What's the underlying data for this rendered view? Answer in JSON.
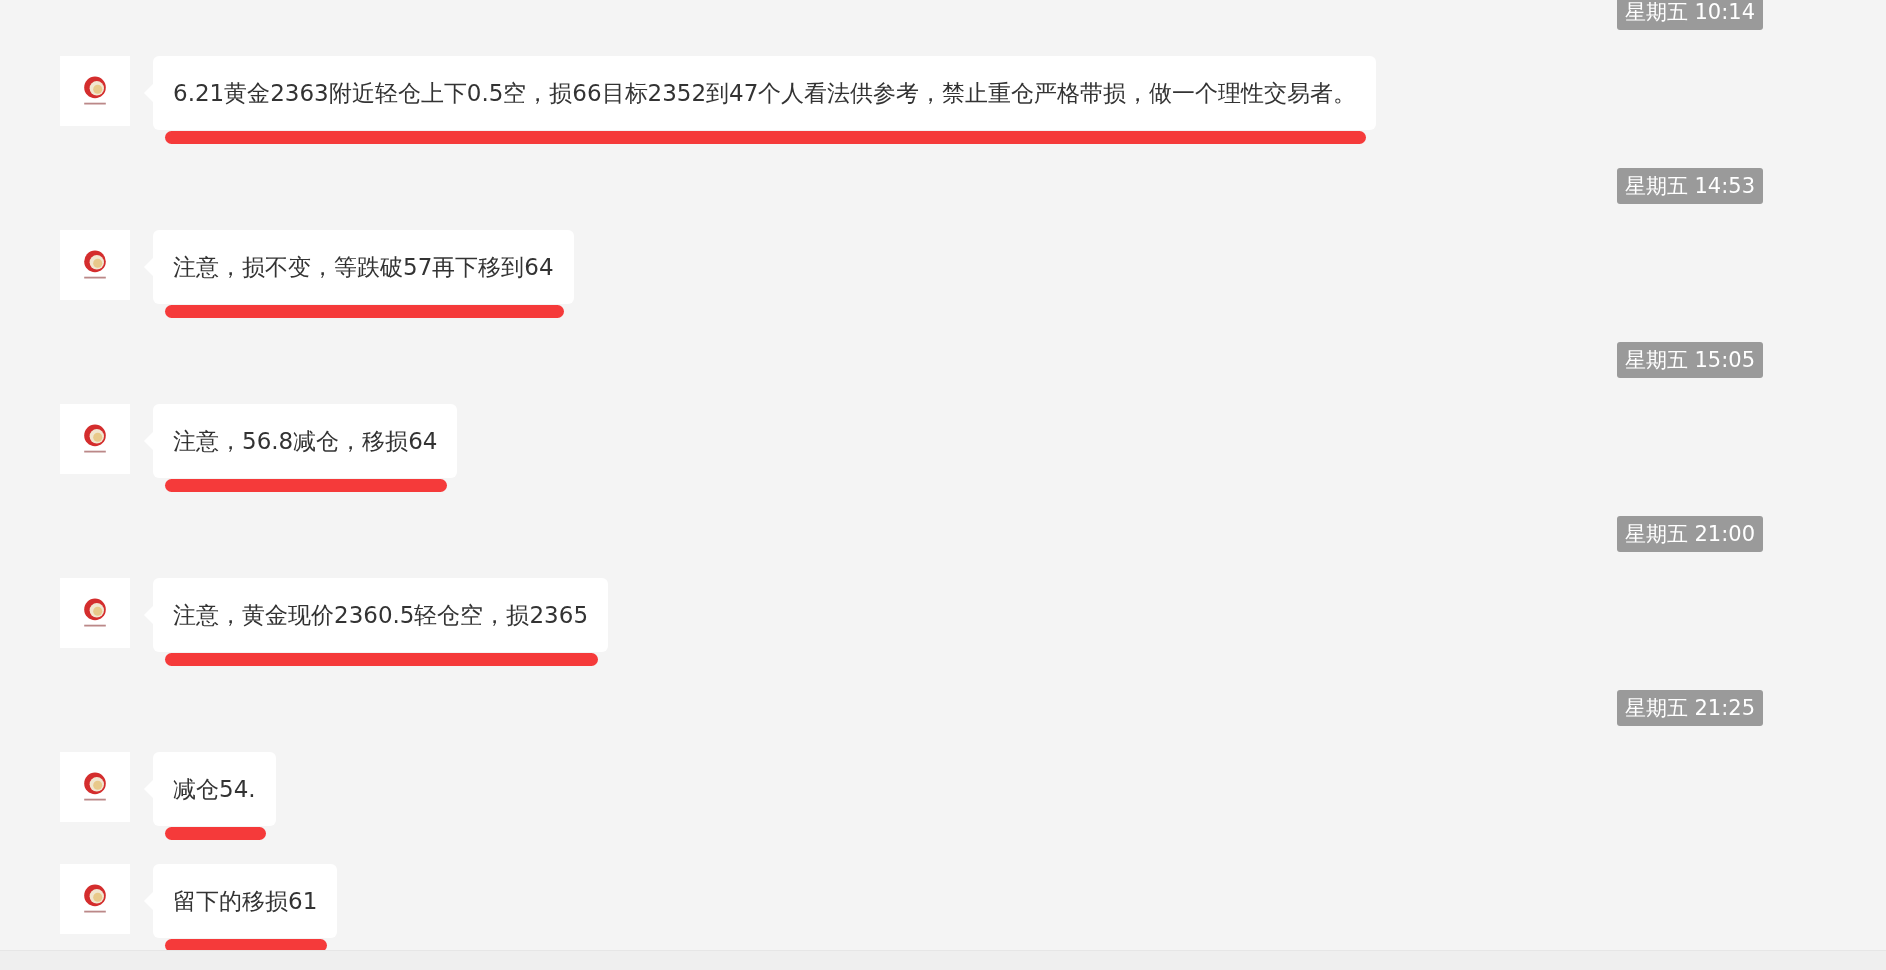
{
  "messages": [
    {
      "kind": "time",
      "text": "星期五 10:14"
    },
    {
      "kind": "message",
      "text": "6.21黄金2363附近轻仓上下0.5空，损66目标2352到47个人看法供参考，禁止重仓严格带损，做一个理性交易者。",
      "underlined": true
    },
    {
      "kind": "time",
      "text": "星期五 14:53"
    },
    {
      "kind": "message",
      "text": "注意，损不变，等跌破57再下移到64",
      "underlined": true
    },
    {
      "kind": "time",
      "text": "星期五 15:05"
    },
    {
      "kind": "message",
      "text": "注意，56.8减仓，移损64",
      "underlined": true
    },
    {
      "kind": "time",
      "text": "星期五 21:00"
    },
    {
      "kind": "message",
      "text": "注意，黄金现价2360.5轻仓空，损2365",
      "underlined": true
    },
    {
      "kind": "time",
      "text": "星期五 21:25"
    },
    {
      "kind": "message",
      "text": "减仓54.",
      "underlined": true
    },
    {
      "kind": "message",
      "text": "留下的移损61",
      "underlined": true
    }
  ]
}
